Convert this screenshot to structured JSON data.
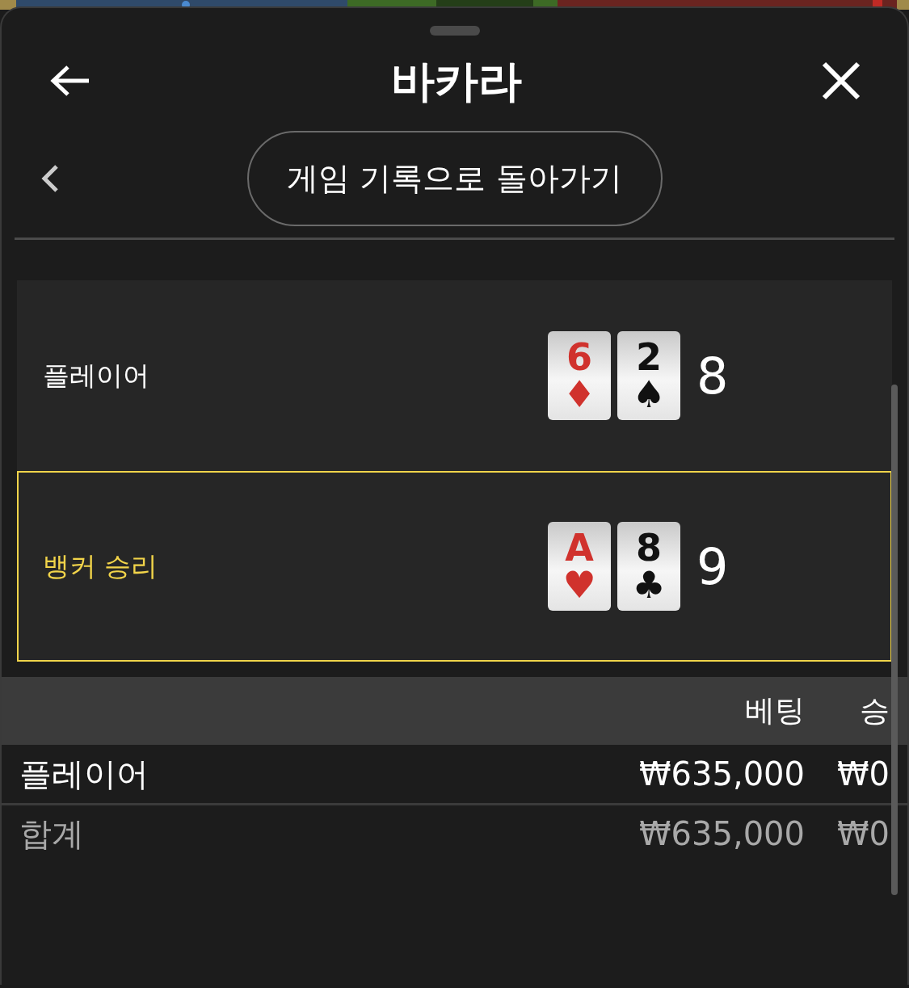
{
  "header": {
    "title": "바카라"
  },
  "nav": {
    "back_button": "게임 기록으로 돌아가기"
  },
  "hands": [
    {
      "label": "플레이어",
      "selected": false,
      "total": "8",
      "cards": [
        {
          "rank": "6",
          "suit": "♦",
          "color": "#d0322d"
        },
        {
          "rank": "2",
          "suit": "♠",
          "color": "#111111"
        }
      ]
    },
    {
      "label": "뱅커 승리",
      "selected": true,
      "total": "9",
      "cards": [
        {
          "rank": "A",
          "suit": "♥",
          "color": "#d0322d"
        },
        {
          "rank": "8",
          "suit": "♣",
          "color": "#111111"
        }
      ]
    }
  ],
  "bets_table": {
    "columns": [
      "베팅",
      "승"
    ],
    "rows": [
      {
        "kind": "bet",
        "label": "플레이어",
        "cells": [
          "₩635,000",
          "₩0"
        ]
      },
      {
        "kind": "total",
        "label": "합계",
        "cells": [
          "₩635,000",
          "₩0"
        ]
      }
    ]
  }
}
